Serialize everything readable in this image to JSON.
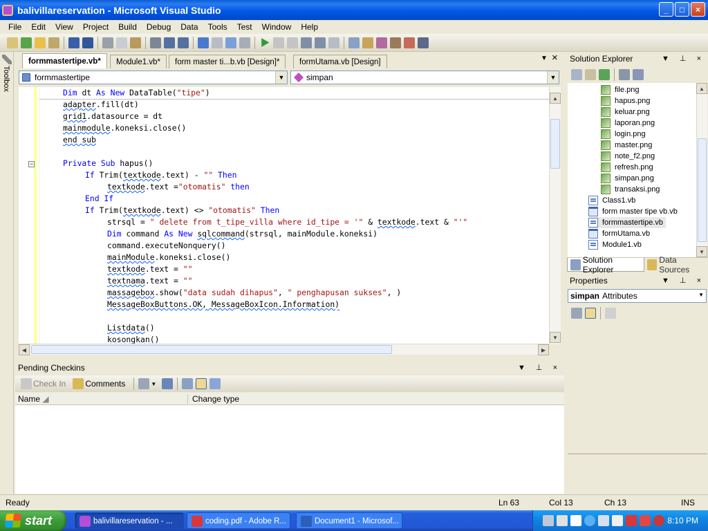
{
  "window": {
    "title": "balivillareservation - Microsoft Visual Studio",
    "min": "_",
    "max": "□",
    "close": "×"
  },
  "menu": [
    "File",
    "Edit",
    "View",
    "Project",
    "Build",
    "Debug",
    "Data",
    "Tools",
    "Test",
    "Window",
    "Help"
  ],
  "toolbox_label": "Toolbox",
  "editor": {
    "tabs": [
      "formmastertipe.vb*",
      "Module1.vb*",
      "form master ti...b.vb [Design]*",
      "formUtama.vb [Design]"
    ],
    "class_combo": "formmastertipe",
    "method_combo": "simpan"
  },
  "code": {
    "l1": [
      "Dim ",
      "dt ",
      "As ",
      "New ",
      "DataTable(",
      "\"tipe\"",
      ")"
    ],
    "l2": [
      "adapter",
      ".fill(dt)"
    ],
    "l3": [
      "grid1",
      ".datasource = dt"
    ],
    "l4": [
      "mainmodule",
      ".koneksi.close()"
    ],
    "l5": [
      "end sub"
    ],
    "l7": [
      "Private ",
      "Sub ",
      "hapus()"
    ],
    "l8": [
      "If ",
      "Trim(",
      "textkode",
      ".text) - ",
      "\"\"",
      " Then"
    ],
    "l9": [
      "textkode",
      ".text =",
      "\"otomatis\"",
      " then"
    ],
    "l10": [
      "End If"
    ],
    "l11": [
      "If ",
      "Trim(",
      "textkode",
      ".text) <> ",
      "\"otomatis\"",
      " Then"
    ],
    "l12": [
      "strsql = ",
      "\" delete from t_tipe_villa where id_tipe = '\"",
      " & ",
      "textkode",
      ".text & ",
      "\"'\""
    ],
    "l13": [
      "Dim ",
      "command ",
      "As ",
      "New ",
      "sqlcommand",
      "(strsql, mainModule.koneksi)"
    ],
    "l14": [
      "command.executeNonquery()"
    ],
    "l15": [
      "mainModule",
      ".koneksi.close()"
    ],
    "l16": [
      "textkode",
      ".text = ",
      "\"\""
    ],
    "l17": [
      "textnama",
      ".text = ",
      "\"\""
    ],
    "l18": [
      "massagebox",
      ".show(",
      "\"data sudah dihapus\"",
      ", ",
      "\" penghapusan sukses\"",
      ", )"
    ],
    "l19": [
      "MessageBoxButtons.OK,",
      " MessageBoxIcon.Information)"
    ],
    "l21": [
      "Listdata",
      "()"
    ],
    "l22": [
      "kosongkan",
      "()"
    ]
  },
  "pending": {
    "title": "Pending Checkins",
    "check_in": "Check In",
    "comments": "Comments",
    "col_name": "Name",
    "col_change": "Change type"
  },
  "solution_explorer": {
    "title": "Solution Explorer",
    "items": [
      "file.png",
      "hapus.png",
      "keluar.png",
      "laporan.png",
      "login.png",
      "master.png",
      "note_f2.png",
      "refresh.png",
      "simpan.png",
      "transaksi.png",
      "Class1.vb",
      "form master tipe vb.vb",
      "formmastertipe.vb",
      "formUtama.vb",
      "Module1.vb"
    ],
    "tab_solution": "Solution Explorer",
    "tab_data": "Data Sources"
  },
  "properties": {
    "title": "Properties",
    "object": "simpan",
    "object_type": "Attributes"
  },
  "status": {
    "ready": "Ready",
    "ln": "Ln 63",
    "col": "Col 13",
    "ch": "Ch 13",
    "mode": "INS"
  },
  "taskbar": {
    "start": "start",
    "tasks": [
      "balivillareservation - ...",
      "coding.pdf - Adobe R...",
      "Document1 - Microsof..."
    ],
    "clock": "8:10 PM"
  },
  "colors": {
    "keyword": "#0000ff",
    "string": "#a31515",
    "taskbar": "#245edb",
    "titlebar": "#0058e6"
  }
}
